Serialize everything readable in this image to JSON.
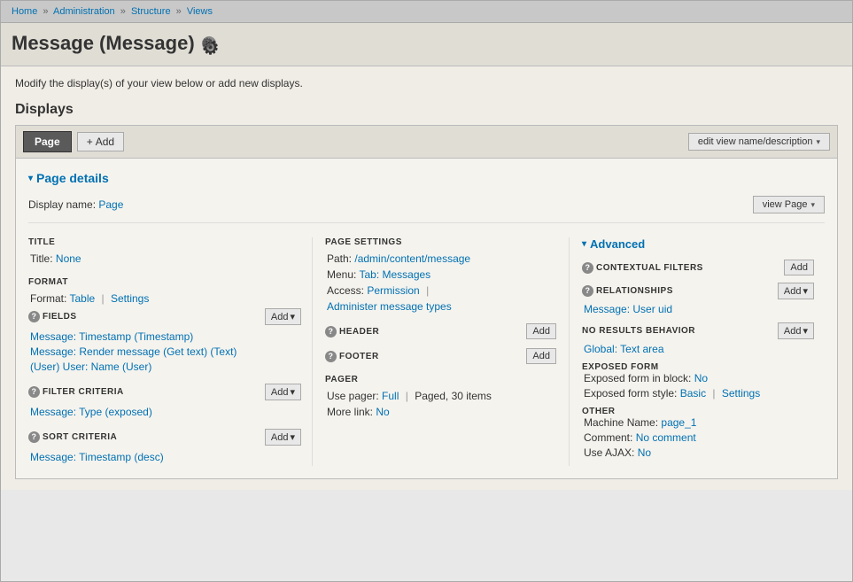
{
  "breadcrumb": {
    "items": [
      "Home",
      "Administration",
      "Structure",
      "Views"
    ],
    "separators": [
      "»",
      "»",
      "»"
    ]
  },
  "page": {
    "title": "Message (Message)",
    "intro": "Modify the display(s) of your view below or add new displays."
  },
  "displays": {
    "label": "Displays",
    "tabs": [
      {
        "label": "Page",
        "active": true
      }
    ],
    "add_button": "+ Add",
    "edit_view_button": "edit view name/description"
  },
  "page_details": {
    "header": "Page details",
    "display_name_label": "Display name:",
    "display_name_value": "Page",
    "view_page_button": "view Page"
  },
  "left_col": {
    "title_heading": "TITLE",
    "title_value": "None",
    "format_heading": "FORMAT",
    "format_value": "Table",
    "format_settings": "Settings",
    "fields_heading": "FIELDS",
    "fields": [
      "Message: Timestamp (Timestamp)",
      "Message: Render message (Get text) (Text)",
      "(User) User: Name (User)"
    ],
    "filter_heading": "FILTER CRITERIA",
    "filter_items": [
      "Message: Type (exposed)"
    ],
    "sort_heading": "SORT CRITERIA",
    "sort_items": [
      "Message: Timestamp (desc)"
    ]
  },
  "middle_col": {
    "page_settings_heading": "PAGE SETTINGS",
    "path_label": "Path:",
    "path_value": "/admin/content/message",
    "menu_label": "Menu:",
    "menu_value": "Tab: Messages",
    "access_label": "Access:",
    "access_value": "Permission",
    "access_extra": "Administer message types",
    "header_heading": "HEADER",
    "footer_heading": "FOOTER",
    "pager_heading": "PAGER",
    "use_pager_label": "Use pager:",
    "use_pager_value": "Full",
    "use_pager_extra": "Paged, 30 items",
    "more_link_label": "More link:",
    "more_link_value": "No"
  },
  "right_col": {
    "advanced_header": "Advanced",
    "contextual_filters_heading": "CONTEXTUAL FILTERS",
    "relationships_heading": "RELATIONSHIPS",
    "relationships_value": "Message: User uid",
    "no_results_heading": "NO RESULTS BEHAVIOR",
    "no_results_value": "Global: Text area",
    "exposed_form_heading": "EXPOSED FORM",
    "exposed_form_block_label": "Exposed form in block:",
    "exposed_form_block_value": "No",
    "exposed_form_style_label": "Exposed form style:",
    "exposed_form_style_value": "Basic",
    "exposed_form_settings": "Settings",
    "other_heading": "OTHER",
    "machine_name_label": "Machine Name:",
    "machine_name_value": "page_1",
    "comment_label": "Comment:",
    "comment_value": "No comment",
    "ajax_label": "Use AJAX:",
    "ajax_value": "No"
  },
  "icons": {
    "gear": "⚙",
    "triangle_down": "▾",
    "question": "?",
    "plus": "+"
  }
}
